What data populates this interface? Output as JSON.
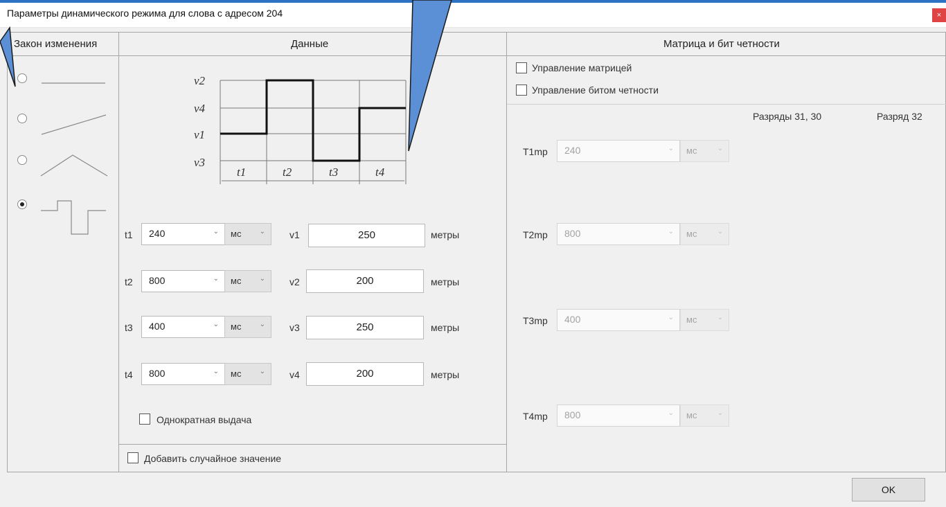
{
  "window": {
    "title": "Параметры динамического режима для слова с адресом 204",
    "close_label": "×"
  },
  "law": {
    "header": "Закон изменения"
  },
  "data_panel": {
    "header": "Данные",
    "diagram": {
      "v_labels": [
        "v2",
        "v4",
        "v1",
        "v3"
      ],
      "t_labels": [
        "t1",
        "t2",
        "t3",
        "t4"
      ]
    },
    "rows": [
      {
        "t_label": "t1",
        "t_value": "240",
        "unit": "мс",
        "v_label": "v1",
        "v_value": "250",
        "v_unit": "метры"
      },
      {
        "t_label": "t2",
        "t_value": "800",
        "unit": "мс",
        "v_label": "v2",
        "v_value": "200",
        "v_unit": "метры"
      },
      {
        "t_label": "t3",
        "t_value": "400",
        "unit": "мс",
        "v_label": "v3",
        "v_value": "250",
        "v_unit": "метры"
      },
      {
        "t_label": "t4",
        "t_value": "800",
        "unit": "мс",
        "v_label": "v4",
        "v_value": "200",
        "v_unit": "метры"
      }
    ],
    "single_output_label": "Однократная выдача",
    "add_random_label": "Добавить случайное значение"
  },
  "matrix_panel": {
    "header": "Матрица и бит четности",
    "matrix_control_label": "Управление матрицей",
    "parity_control_label": "Управление битом четности",
    "col_bits_31_30": "Разряды 31, 30",
    "col_bit_32": "Разряд 32",
    "rows": [
      {
        "label": "T1mp",
        "value": "240",
        "unit": "мс"
      },
      {
        "label": "T2mp",
        "value": "800",
        "unit": "мс"
      },
      {
        "label": "T3mp",
        "value": "400",
        "unit": "мс"
      },
      {
        "label": "T4mp",
        "value": "800",
        "unit": "мс"
      }
    ]
  },
  "footer": {
    "ok_label": "OK"
  },
  "icons": {
    "chevron": "⌄"
  },
  "colors": {
    "accent": "#2e72c4",
    "callout": "#5b8fd6",
    "close": "#e04343"
  }
}
